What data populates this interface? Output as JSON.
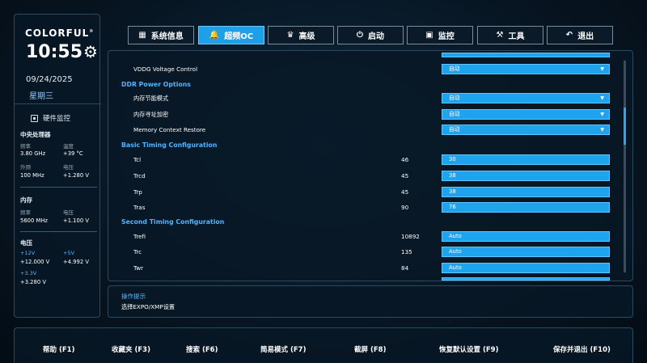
{
  "sidebar": {
    "brand": "COLORFUL",
    "brand_mark": "®",
    "time": "10:55",
    "date": "09/24/2025",
    "weekday": "星期三",
    "hw_monitor_title": "硬件监控",
    "cpu": {
      "title": "中央处理器",
      "freq_label": "频率",
      "freq_value": "3.80 GHz",
      "temp_label": "温度",
      "temp_value": "+39 °C",
      "ext_label": "外频",
      "ext_value": "100 MHz",
      "volt_label": "电压",
      "volt_value": "+1.280 V"
    },
    "memory": {
      "title": "内存",
      "freq_label": "频率",
      "freq_value": "5600 MHz",
      "volt_label": "电压",
      "volt_value": "+1.100 V"
    },
    "voltage": {
      "title": "电压",
      "v12_label": "+12V",
      "v12_value": "+12.000 V",
      "v5_label": "+5V",
      "v5_value": "+4.992 V",
      "v33_label": "+3.3V",
      "v33_value": "+3.280 V"
    }
  },
  "tabs": [
    {
      "label": "系统信息",
      "icon": "grid-icon",
      "active": false
    },
    {
      "label": "超频OC",
      "icon": "rocket-icon",
      "active": true
    },
    {
      "label": "高级",
      "icon": "crown-icon",
      "active": false
    },
    {
      "label": "启动",
      "icon": "power-icon",
      "active": false
    },
    {
      "label": "监控",
      "icon": "monitor-icon",
      "active": false
    },
    {
      "label": "工具",
      "icon": "toolbox-icon",
      "active": false
    },
    {
      "label": "退出",
      "icon": "exit-arrow-icon",
      "active": false
    }
  ],
  "main": {
    "top_field_value": "自动",
    "vddg": {
      "label": "VDDG Voltage Control",
      "value": "自动"
    },
    "ddr_power_title": "DDR Power Options",
    "mem_power_save": {
      "label": "内存节能模式",
      "value": "自动"
    },
    "mem_addr_enc": {
      "label": "内存寻址加密",
      "value": "自动"
    },
    "mem_ctx_restore": {
      "label": "Memory Context Restore",
      "value": "自动"
    },
    "basic_timing_title": "Basic Timing Configuration",
    "tcl": {
      "label": "Tcl",
      "current": "46",
      "value": "30"
    },
    "trcd": {
      "label": "Trcd",
      "current": "45",
      "value": "38"
    },
    "trp": {
      "label": "Trp",
      "current": "45",
      "value": "38"
    },
    "tras": {
      "label": "Tras",
      "current": "90",
      "value": "76"
    },
    "second_timing_title": "Second Timing Configuration",
    "trefi": {
      "label": "Trefi",
      "current": "10892",
      "value": "Auto"
    },
    "trc": {
      "label": "Trc",
      "current": "135",
      "value": "Auto"
    },
    "twr": {
      "label": "Twr",
      "current": "84",
      "value": "Auto"
    }
  },
  "hint": {
    "title": "操作提示",
    "text": "选择EXPO/XMP设置"
  },
  "footer": {
    "help": "帮助 (F1)",
    "favorites": "收藏夹 (F3)",
    "search": "搜索 (F6)",
    "easy_mode": "简易模式 (F7)",
    "screenshot": "截屏 (F8)",
    "restore_defaults": "恢复默认设置 (F9)",
    "save_exit": "保存并退出 (F10)"
  },
  "colors": {
    "accent": "#1ea3ee",
    "section_title": "#4fb3ff",
    "background": "#071522"
  }
}
